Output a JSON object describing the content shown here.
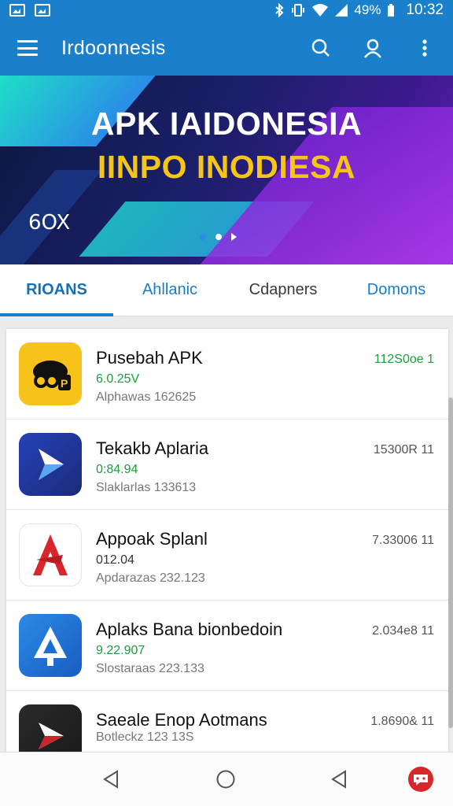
{
  "status_bar": {
    "time": "10:32",
    "battery": "49%",
    "left_icons": [
      "gallery-icon",
      "image-icon"
    ],
    "right_icons": [
      "bluetooth-icon",
      "vibrate-icon",
      "wifi-icon",
      "signal-icon",
      "battery-icon"
    ]
  },
  "app_bar": {
    "title": "Irdoonnesis",
    "actions": [
      "search-icon",
      "account-icon",
      "more-vert-icon"
    ]
  },
  "banner": {
    "line1": "APK IAIDONESIA",
    "line2": "IINPO INODIESA",
    "logo_text": "6OX",
    "colors": {
      "headline": "#ffffff",
      "subheadline": "#f5c518",
      "dot_active": "#2a8ce6"
    },
    "dots_total": 3,
    "dots_active_index": 0
  },
  "tabs": [
    {
      "label": "RIOANS",
      "active": true
    },
    {
      "label": "Ahllanic",
      "active": false
    },
    {
      "label": "Cdapners",
      "active": false
    },
    {
      "label": "Domons",
      "active": false
    }
  ],
  "apps": [
    {
      "name": "Pusebah APK",
      "version": "6.0.25V",
      "meta": "Alphawas 162625",
      "size": "112S0oe 1",
      "version_green": true,
      "size_green": true
    },
    {
      "name": "Tekakb Aplaria",
      "version": "0:84.94",
      "meta": "Slaklarlas 133613",
      "size": "15300R 11",
      "version_green": true,
      "size_green": false
    },
    {
      "name": "Appoak Splanl",
      "version": "012.04",
      "meta": "Apdarazas 232.123",
      "size": "7.33006 11",
      "version_green": false,
      "size_green": false
    },
    {
      "name": "Aplaks Bana bionbedoin",
      "version": "9.22.907",
      "meta": "Slostaraas 223.133",
      "size": "2.034e8 11",
      "version_green": true,
      "size_green": false
    },
    {
      "name": "Saeale Enop Aotmans",
      "version": "",
      "meta": "Botleckz 123 13S",
      "size": "1.8690& 11",
      "version_green": false,
      "size_green": false
    }
  ],
  "colors": {
    "primary": "#1a80cc",
    "accent_green": "#1c9d3a",
    "tab_active": "#1a6fb3"
  },
  "nav_bar": [
    "back-icon",
    "home-icon",
    "recents-icon",
    "chat-fab-icon"
  ]
}
